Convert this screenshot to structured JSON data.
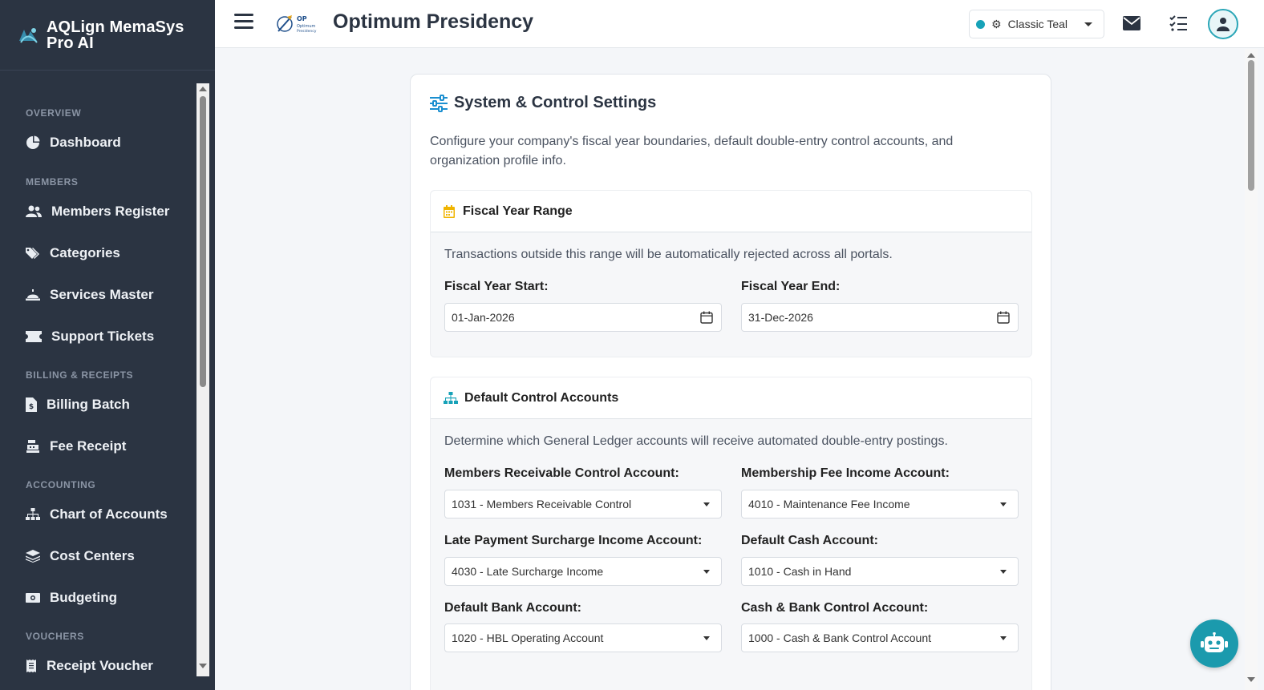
{
  "brand": {
    "name": "AQLign MemaSys Pro AI"
  },
  "sidebar": {
    "sections": [
      {
        "title": "OVERVIEW"
      },
      {
        "title": "MEMBERS"
      },
      {
        "title": "BILLING & RECEIPTS"
      },
      {
        "title": "ACCOUNTING"
      },
      {
        "title": "VOUCHERS"
      }
    ],
    "items": [
      {
        "label": "Dashboard",
        "icon": "pie-chart-icon"
      },
      {
        "label": "Members Register",
        "icon": "users-icon"
      },
      {
        "label": "Categories",
        "icon": "tags-icon"
      },
      {
        "label": "Services Master",
        "icon": "bell-concierge-icon"
      },
      {
        "label": "Support Tickets",
        "icon": "ticket-icon"
      },
      {
        "label": "Billing Batch",
        "icon": "file-invoice-icon"
      },
      {
        "label": "Fee Receipt",
        "icon": "cash-register-icon"
      },
      {
        "label": "Chart of Accounts",
        "icon": "sitemap-icon"
      },
      {
        "label": "Cost Centers",
        "icon": "layers-icon"
      },
      {
        "label": "Budgeting",
        "icon": "money-bill-icon"
      },
      {
        "label": "Receipt Voucher",
        "icon": "receipt-icon"
      }
    ]
  },
  "header": {
    "title": "Optimum Presidency",
    "theme": {
      "label": "Classic Teal",
      "dot_color": "#17a2b8"
    }
  },
  "card": {
    "title": "System & Control Settings",
    "description": "Configure your company's fiscal year boundaries, default double-entry control accounts, and organization profile info.",
    "fiscal": {
      "title": "Fiscal Year Range",
      "note": "Transactions outside this range will be automatically rejected across all portals.",
      "start_label": "Fiscal Year Start:",
      "start_value": "01-Jan-2026",
      "end_label": "Fiscal Year End:",
      "end_value": "31-Dec-2026"
    },
    "accounts": {
      "title": "Default Control Accounts",
      "note": "Determine which General Ledger accounts will receive automated double-entry postings.",
      "fields": [
        {
          "label": "Members Receivable Control Account:",
          "value": "1031 - Members Receivable Control"
        },
        {
          "label": "Membership Fee Income Account:",
          "value": "4010 - Maintenance Fee Income"
        },
        {
          "label": "Late Payment Surcharge Income Account:",
          "value": "4030 - Late Surcharge Income"
        },
        {
          "label": "Default Cash Account:",
          "value": "1010 - Cash in Hand"
        },
        {
          "label": "Default Bank Account:",
          "value": "1020 - HBL Operating Account"
        },
        {
          "label": "Cash & Bank Control Account:",
          "value": "1000 - Cash & Bank Control Account"
        }
      ]
    }
  },
  "colors": {
    "sidebar_bg": "#2b3442",
    "accent": "#1b9aad",
    "calendar_icon": "#f0b400"
  }
}
